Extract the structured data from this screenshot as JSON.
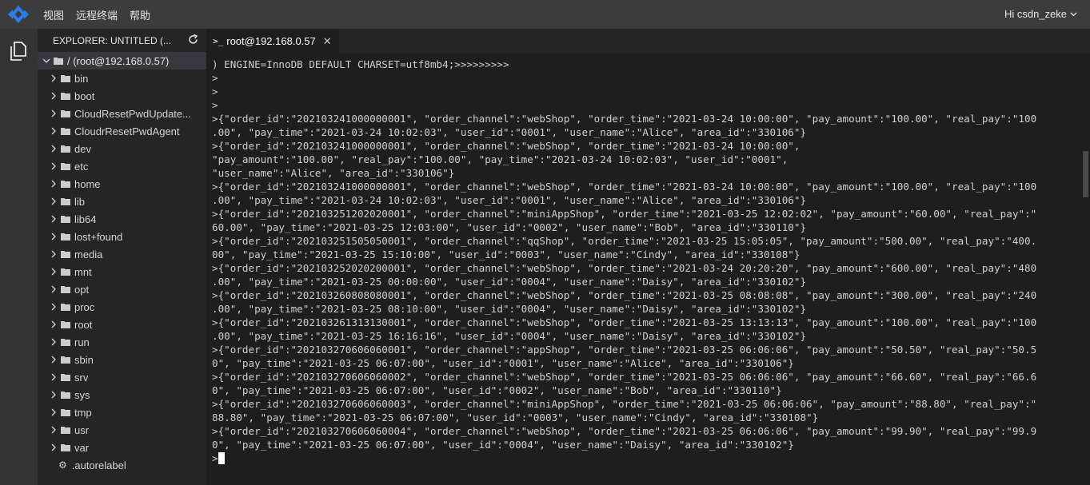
{
  "menubar": {
    "items": [
      "视图",
      "远程终端",
      "帮助"
    ],
    "user": "Hi csdn_zeke"
  },
  "sidebar": {
    "title": "EXPLORER: UNTITLED (...",
    "root": "/ (root@192.168.0.57)",
    "folders": [
      "bin",
      "boot",
      "CloudResetPwdUpdate...",
      "CloudrResetPwdAgent",
      "dev",
      "etc",
      "home",
      "lib",
      "lib64",
      "lost+found",
      "media",
      "mnt",
      "opt",
      "proc",
      "root",
      "run",
      "sbin",
      "srv",
      "sys",
      "tmp",
      "usr",
      "var"
    ],
    "files": [
      ".autorelabel"
    ]
  },
  "tab": {
    "label": "root@192.168.0.57"
  },
  "terminal": {
    "lines": [
      ") ENGINE=InnoDB DEFAULT CHARSET=utf8mb4;>>>>>>>>>",
      ">",
      ">",
      ">",
      ">{\"order_id\":\"202103241000000001\", \"order_channel\":\"webShop\", \"order_time\":\"2021-03-24 10:00:00\", \"pay_amount\":\"100.00\", \"real_pay\":\"100",
      ".00\", \"pay_time\":\"2021-03-24 10:02:03\", \"user_id\":\"0001\", \"user_name\":\"Alice\", \"area_id\":\"330106\"}",
      ">{\"order_id\":\"202103241000000001\", \"order_channel\":\"webShop\", \"order_time\":\"2021-03-24 10:00:00\",",
      "\"pay_amount\":\"100.00\", \"real_pay\":\"100.00\", \"pay_time\":\"2021-03-24 10:02:03\", \"user_id\":\"0001\",",
      "\"user_name\":\"Alice\", \"area_id\":\"330106\"}",
      ">{\"order_id\":\"202103241000000001\", \"order_channel\":\"webShop\", \"order_time\":\"2021-03-24 10:00:00\", \"pay_amount\":\"100.00\", \"real_pay\":\"100",
      ".00\", \"pay_time\":\"2021-03-24 10:02:03\", \"user_id\":\"0001\", \"user_name\":\"Alice\", \"area_id\":\"330106\"}",
      ">{\"order_id\":\"202103251202020001\", \"order_channel\":\"miniAppShop\", \"order_time\":\"2021-03-25 12:02:02\", \"pay_amount\":\"60.00\", \"real_pay\":\"",
      "60.00\", \"pay_time\":\"2021-03-25 12:03:00\", \"user_id\":\"0002\", \"user_name\":\"Bob\", \"area_id\":\"330110\"}",
      ">{\"order_id\":\"202103251505050001\", \"order_channel\":\"qqShop\", \"order_time\":\"2021-03-25 15:05:05\", \"pay_amount\":\"500.00\", \"real_pay\":\"400.",
      "00\", \"pay_time\":\"2021-03-25 15:10:00\", \"user_id\":\"0003\", \"user_name\":\"Cindy\", \"area_id\":\"330108\"}",
      ">{\"order_id\":\"202103252020200001\", \"order_channel\":\"webShop\", \"order_time\":\"2021-03-24 20:20:20\", \"pay_amount\":\"600.00\", \"real_pay\":\"480",
      ".00\", \"pay_time\":\"2021-03-25 00:00:00\", \"user_id\":\"0004\", \"user_name\":\"Daisy\", \"area_id\":\"330102\"}",
      ">{\"order_id\":\"202103260808080001\", \"order_channel\":\"webShop\", \"order_time\":\"2021-03-25 08:08:08\", \"pay_amount\":\"300.00\", \"real_pay\":\"240",
      ".00\", \"pay_time\":\"2021-03-25 08:10:00\", \"user_id\":\"0004\", \"user_name\":\"Daisy\", \"area_id\":\"330102\"}",
      ">{\"order_id\":\"202103261313130001\", \"order_channel\":\"webShop\", \"order_time\":\"2021-03-25 13:13:13\", \"pay_amount\":\"100.00\", \"real_pay\":\"100",
      ".00\", \"pay_time\":\"2021-03-25 16:16:16\", \"user_id\":\"0004\", \"user_name\":\"Daisy\", \"area_id\":\"330102\"}",
      ">{\"order_id\":\"202103270606060001\", \"order_channel\":\"appShop\", \"order_time\":\"2021-03-25 06:06:06\", \"pay_amount\":\"50.50\", \"real_pay\":\"50.5",
      "0\", \"pay_time\":\"2021-03-25 06:07:00\", \"user_id\":\"0001\", \"user_name\":\"Alice\", \"area_id\":\"330106\"}",
      ">{\"order_id\":\"202103270606060002\", \"order_channel\":\"webShop\", \"order_time\":\"2021-03-25 06:06:06\", \"pay_amount\":\"66.60\", \"real_pay\":\"66.6",
      "0\", \"pay_time\":\"2021-03-25 06:07:00\", \"user_id\":\"0002\", \"user_name\":\"Bob\", \"area_id\":\"330110\"}",
      ">{\"order_id\":\"202103270606060003\", \"order_channel\":\"miniAppShop\", \"order_time\":\"2021-03-25 06:06:06\", \"pay_amount\":\"88.80\", \"real_pay\":\"",
      "88.80\", \"pay_time\":\"2021-03-25 06:07:00\", \"user_id\":\"0003\", \"user_name\":\"Cindy\", \"area_id\":\"330108\"}",
      ">{\"order_id\":\"202103270606060004\", \"order_channel\":\"webShop\", \"order_time\":\"2021-03-25 06:06:06\", \"pay_amount\":\"99.90\", \"real_pay\":\"99.9",
      "0\", \"pay_time\":\"2021-03-25 06:07:00\", \"user_id\":\"0004\", \"user_name\":\"Daisy\", \"area_id\":\"330102\"}"
    ],
    "prompt": ">"
  },
  "colors": {
    "menubar": "#3c3c3c",
    "sidebar": "#252526",
    "activitybar": "#333333",
    "terminal": "#1e1e1e",
    "accent": "#2b7de9"
  }
}
